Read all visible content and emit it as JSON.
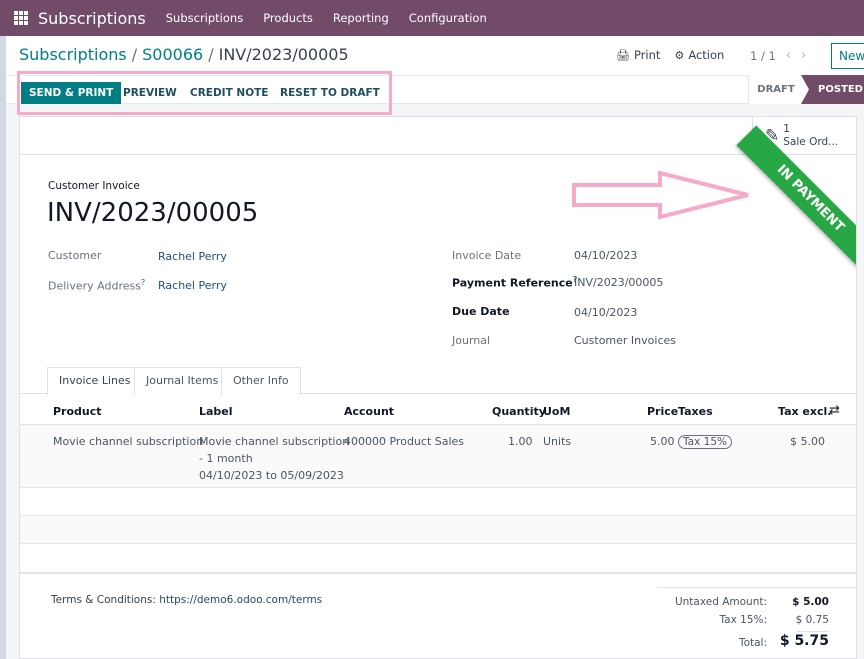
{
  "navbar": {
    "app_name": "Subscriptions",
    "menu": [
      "Subscriptions",
      "Products",
      "Reporting",
      "Configuration"
    ]
  },
  "breadcrumb": {
    "items": [
      "Subscriptions",
      "S00066",
      "INV/2023/00005"
    ]
  },
  "control_panel": {
    "print_label": "Print",
    "action_label": "Action",
    "pager": "1 / 1",
    "new_label": "New"
  },
  "status_actions": {
    "send_print": "SEND & PRINT",
    "preview": "PREVIEW",
    "credit_note": "CREDIT NOTE",
    "reset_to_draft": "RESET TO DRAFT"
  },
  "statusbar": {
    "stages": [
      "DRAFT",
      "POSTED"
    ],
    "current": "POSTED"
  },
  "smart_button": {
    "count": "1",
    "label": "Sale Ord..."
  },
  "ribbon": {
    "text": "IN PAYMENT",
    "color": "#28a745"
  },
  "invoice": {
    "type": "Customer Invoice",
    "number": "INV/2023/00005",
    "left_fields": [
      {
        "label": "Customer",
        "value": "Rachel Perry",
        "help": false
      },
      {
        "label": "Delivery Address",
        "value": "Rachel Perry",
        "help": true
      }
    ],
    "right_fields": [
      {
        "label": "Invoice Date",
        "value": "04/10/2023",
        "bold": false,
        "help": false
      },
      {
        "label": "Payment Reference",
        "value": "INV/2023/00005",
        "bold": true,
        "help": true
      },
      {
        "label": "Due Date",
        "value": "04/10/2023",
        "bold": true,
        "help": false
      },
      {
        "label": "Journal",
        "value": "Customer Invoices",
        "bold": false,
        "help": false
      }
    ]
  },
  "tabs": [
    "Invoice Lines",
    "Journal Items",
    "Other Info"
  ],
  "lines_table": {
    "headers": [
      "Product",
      "Label",
      "Account",
      "Quantity",
      "UoM",
      "Price",
      "Taxes",
      "Tax excl."
    ],
    "rows": [
      {
        "product": "Movie channel subscription",
        "label_lines": [
          "Movie channel subscription",
          "- 1 month",
          "04/10/2023 to 05/09/2023"
        ],
        "account": "400000 Product Sales",
        "quantity": "1.00",
        "uom": "Units",
        "price": "5.00",
        "taxes": "Tax 15%",
        "tax_excl": "$ 5.00"
      }
    ]
  },
  "footer": {
    "terms_label": "Terms & Conditions:",
    "terms_link": "https://demo6.odoo.com/terms",
    "totals": {
      "untaxed_label": "Untaxed Amount:",
      "untaxed_value": "$ 5.00",
      "tax_label": "Tax 15%:",
      "tax_value": "$ 0.75",
      "total_label": "Total:",
      "total_value": "$ 5.75"
    }
  },
  "colors": {
    "brand": "#714b67",
    "primary": "#017e84",
    "annotation": "#f6aac9"
  }
}
